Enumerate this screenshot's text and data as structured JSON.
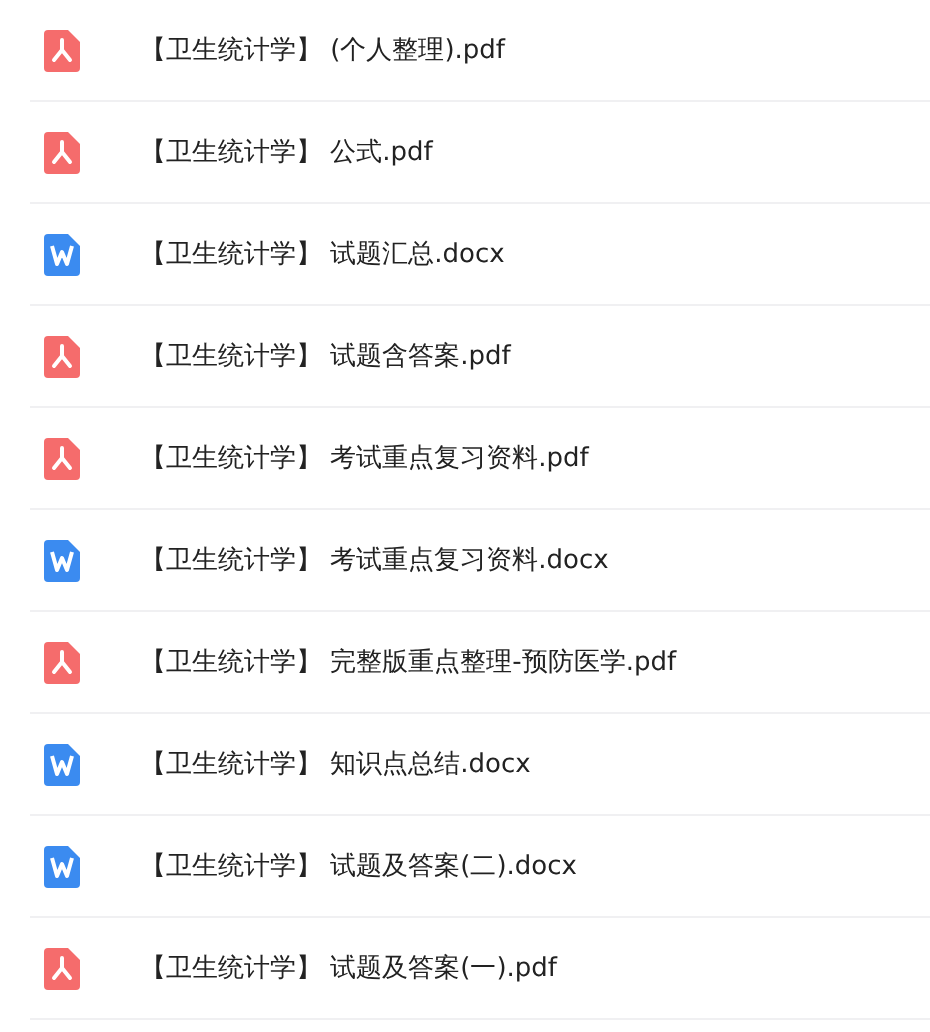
{
  "files": [
    {
      "kind": "pdf",
      "name": "【卫生统计学】 (个人整理).pdf"
    },
    {
      "kind": "pdf",
      "name": "【卫生统计学】 公式.pdf"
    },
    {
      "kind": "docx",
      "name": "【卫生统计学】 试题汇总.docx"
    },
    {
      "kind": "pdf",
      "name": "【卫生统计学】 试题含答案.pdf"
    },
    {
      "kind": "pdf",
      "name": "【卫生统计学】 考试重点复习资料.pdf"
    },
    {
      "kind": "docx",
      "name": "【卫生统计学】 考试重点复习资料.docx"
    },
    {
      "kind": "pdf",
      "name": "【卫生统计学】 完整版重点整理-预防医学.pdf"
    },
    {
      "kind": "docx",
      "name": "【卫生统计学】 知识点总结.docx"
    },
    {
      "kind": "docx",
      "name": "【卫生统计学】 试题及答案(二).docx"
    },
    {
      "kind": "pdf",
      "name": "【卫生统计学】 试题及答案(一).pdf"
    }
  ]
}
